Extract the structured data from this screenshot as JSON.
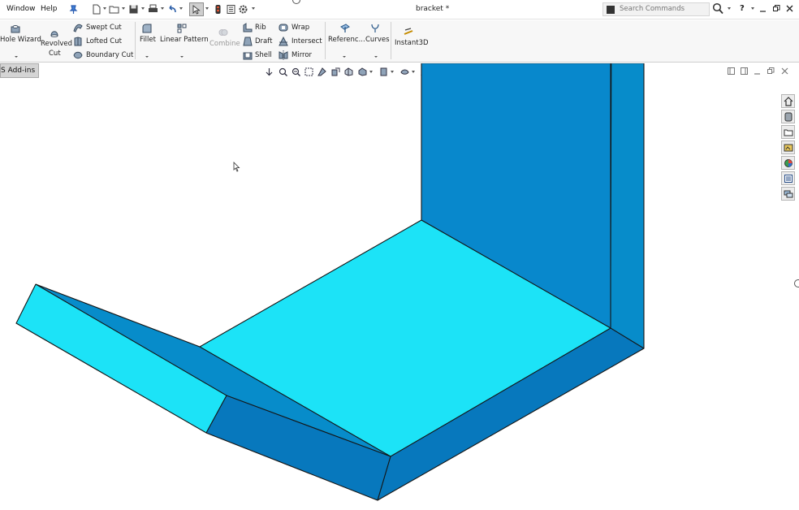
{
  "menu": {
    "window": "Window",
    "help": "Help"
  },
  "document": {
    "title": "bracket *"
  },
  "search": {
    "placeholder": "Search Commands"
  },
  "help_label": "?",
  "ribbon": {
    "hole_wizard": "Hole Wizard",
    "revolved_cut_1": "Revolved",
    "revolved_cut_2": "Cut",
    "swept_cut": "Swept Cut",
    "lofted_cut": "Lofted Cut",
    "boundary_cut": "Boundary Cut",
    "fillet": "Fillet",
    "linear_pattern": "Linear Pattern",
    "combine": "Combine",
    "rib": "Rib",
    "wrap": "Wrap",
    "draft": "Draft",
    "intersect": "Intersect",
    "shell": "Shell",
    "mirror": "Mirror",
    "reference": "Referenc...",
    "curves": "Curves",
    "instant3d": "Instant3D"
  },
  "viewport": {
    "addins_tab": "S Add-ins"
  },
  "colors": {
    "top_face": "#1ce3f7",
    "front_face": "#078cca",
    "dark_face": "#0778bd",
    "wall_face": "#0888cc",
    "edge": "#151515"
  }
}
